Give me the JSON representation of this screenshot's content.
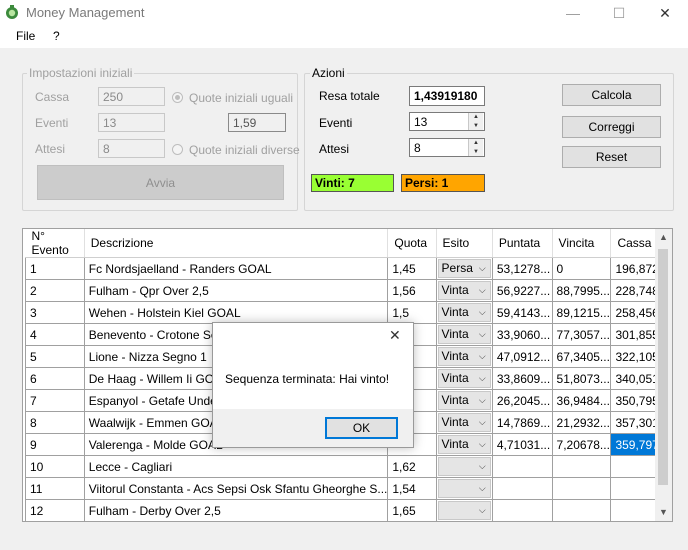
{
  "window": {
    "title": "Money Management",
    "minimize_glyph": "—",
    "maximize_glyph": "☐",
    "close_glyph": "✕",
    "icon": "money-app-icon"
  },
  "menu": {
    "file": "File",
    "help": "?"
  },
  "settings": {
    "group_label": "Impostazioni iniziali",
    "cassa_label": "Cassa",
    "cassa_value": "250",
    "eventi_label": "Eventi",
    "eventi_value": "13",
    "attesi_label": "Attesi",
    "attesi_value": "8",
    "quote_uguali_label": "Quote iniziali uguali",
    "quote_value": "1,59",
    "quote_diverse_label": "Quote iniziali diverse",
    "avvia_label": "Avvia"
  },
  "actions": {
    "group_label": "Azioni",
    "resa_label": "Resa totale",
    "resa_value": "1,43919180",
    "eventi_label": "Eventi",
    "eventi_value": "13",
    "attesi_label": "Attesi",
    "attesi_value": "8",
    "vinti_label": "Vinti: 7",
    "persi_label": "Persi: 1",
    "vinti_color": "#99ff33",
    "persi_color": "#ffa500"
  },
  "buttons": {
    "calcola": "Calcola",
    "correggi": "Correggi",
    "reset": "Reset"
  },
  "grid": {
    "columns": [
      "N° Evento",
      "Descrizione",
      "Quota",
      "Esito",
      "Puntata",
      "Vincita",
      "Cassa"
    ],
    "rows": [
      {
        "n": "1",
        "desc": "Fc Nordsjaelland - Randers GOAL",
        "quota": "1,45",
        "esito": "Persa",
        "puntata": "53,1278...",
        "vincita": "0",
        "cassa": "196,872..."
      },
      {
        "n": "2",
        "desc": "Fulham - Qpr Over 2,5",
        "quota": "1,56",
        "esito": "Vinta",
        "puntata": "56,9227...",
        "vincita": "88,7995...",
        "cassa": "228,748..."
      },
      {
        "n": "3",
        "desc": "Wehen - Holstein Kiel GOAL",
        "quota": "1,5",
        "esito": "Vinta",
        "puntata": "59,4143...",
        "vincita": "89,1215...",
        "cassa": "258,456..."
      },
      {
        "n": "4",
        "desc": "Benevento - Crotone Segn",
        "quota": "",
        "esito": "Vinta",
        "puntata": "33,9060...",
        "vincita": "77,3057...",
        "cassa": "301,855..."
      },
      {
        "n": "5",
        "desc": "Lione - Nizza Segno 1",
        "quota": "",
        "esito": "Vinta",
        "puntata": "47,0912...",
        "vincita": "67,3405...",
        "cassa": "322,105..."
      },
      {
        "n": "6",
        "desc": "De Haag - Willem Ii GOAL",
        "quota": "",
        "esito": "Vinta",
        "puntata": "33,8609...",
        "vincita": "51,8073...",
        "cassa": "340,051..."
      },
      {
        "n": "7",
        "desc": "Espanyol - Getafe Under 2",
        "quota": "",
        "esito": "Vinta",
        "puntata": "26,2045...",
        "vincita": "36,9484...",
        "cassa": "350,795..."
      },
      {
        "n": "8",
        "desc": "Waalwijk - Emmen GOAL",
        "quota": "",
        "esito": "Vinta",
        "puntata": "14,7869...",
        "vincita": "21,2932...",
        "cassa": "357,301..."
      },
      {
        "n": "9",
        "desc": "Valerenga - Molde GOAL",
        "quota": "",
        "esito": "Vinta",
        "puntata": "4,71031...",
        "vincita": "7,20678...",
        "cassa": "359,797..."
      },
      {
        "n": "10",
        "desc": "Lecce - Cagliari",
        "quota": "1,62",
        "esito": "",
        "puntata": "",
        "vincita": "",
        "cassa": ""
      },
      {
        "n": "11",
        "desc": "Viitorul Constanta - Acs Sepsi Osk Sfantu Gheorghe S...",
        "quota": "1,54",
        "esito": "",
        "puntata": "",
        "vincita": "",
        "cassa": ""
      },
      {
        "n": "12",
        "desc": "Fulham - Derby Over 2,5",
        "quota": "1,65",
        "esito": "",
        "puntata": "",
        "vincita": "",
        "cassa": ""
      }
    ]
  },
  "dialog": {
    "message": "Sequenza terminata: Hai vinto!",
    "ok_label": "OK",
    "close_glyph": "✕"
  }
}
